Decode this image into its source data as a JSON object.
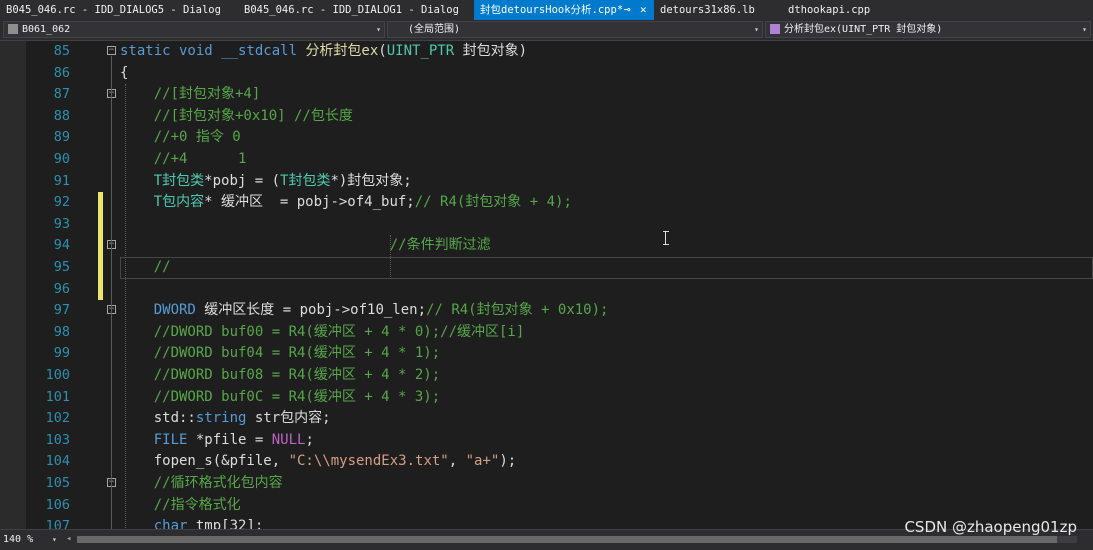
{
  "tabs": [
    {
      "label": "B045_046.rc - IDD_DIALOG5 - Dialog",
      "active": false
    },
    {
      "label": "B045_046.rc - IDD_DIALOG1 - Dialog",
      "active": false
    },
    {
      "label": "封包detoursHook分析.cpp*",
      "active": true,
      "pin": "⊸",
      "close": "✕"
    },
    {
      "label": "detours31x86.lb",
      "active": false
    },
    {
      "label": "dthookapi.cpp",
      "active": false
    }
  ],
  "nav": {
    "project": "B061_062",
    "scope": "(全局范围)",
    "member": "分析封包ex(UINT_PTR 封包对象)",
    "dropdown_glyph": "▾"
  },
  "code_lines": [
    {
      "n": "85",
      "fold": "−",
      "changed": false,
      "tokens": [
        [
          "kw",
          "static void __stdcall "
        ],
        [
          "fn",
          "分析封包ex"
        ],
        [
          "",
          "("
        ],
        [
          "ty",
          "UINT_PTR"
        ],
        [
          "",
          " 封包对象)"
        ]
      ]
    },
    {
      "n": "86",
      "fold": "",
      "changed": false,
      "tokens": [
        [
          "",
          "{"
        ]
      ]
    },
    {
      "n": "87",
      "fold": "−",
      "changed": false,
      "tokens": [
        [
          "",
          "    "
        ],
        [
          "cm",
          "//[封包对象+4]"
        ]
      ]
    },
    {
      "n": "88",
      "fold": "",
      "changed": false,
      "tokens": [
        [
          "",
          "    "
        ],
        [
          "cm",
          "//[封包对象+0x10] //包长度"
        ]
      ]
    },
    {
      "n": "89",
      "fold": "",
      "changed": false,
      "tokens": [
        [
          "",
          "    "
        ],
        [
          "cm",
          "//+0 指令 0"
        ]
      ]
    },
    {
      "n": "90",
      "fold": "",
      "changed": false,
      "tokens": [
        [
          "",
          "    "
        ],
        [
          "cm",
          "//+4      1"
        ]
      ]
    },
    {
      "n": "91",
      "fold": "",
      "changed": false,
      "tokens": [
        [
          "",
          "    "
        ],
        [
          "ty",
          "T封包类"
        ],
        [
          "",
          "*pobj = ("
        ],
        [
          "ty",
          "T封包类"
        ],
        [
          "",
          "*)封包对象;"
        ]
      ]
    },
    {
      "n": "92",
      "fold": "",
      "changed": true,
      "tokens": [
        [
          "",
          "    "
        ],
        [
          "ty",
          "T包内容"
        ],
        [
          "",
          "* 缓冲区  = pobj->of4_buf;"
        ],
        [
          "cm",
          "// R4(封包对象 + 4);"
        ]
      ]
    },
    {
      "n": "93",
      "fold": "",
      "changed": true,
      "tokens": [
        [
          "",
          ""
        ]
      ]
    },
    {
      "n": "94",
      "fold": "−",
      "changed": true,
      "tokens": [
        [
          "",
          "                                "
        ],
        [
          "cm",
          "//条件判断过滤"
        ]
      ]
    },
    {
      "n": "95",
      "fold": "",
      "changed": true,
      "tokens": [
        [
          "",
          "    "
        ],
        [
          "cm",
          "//"
        ]
      ]
    },
    {
      "n": "96",
      "fold": "",
      "changed": true,
      "tokens": [
        [
          "",
          ""
        ]
      ]
    },
    {
      "n": "97",
      "fold": "−",
      "changed": false,
      "tokens": [
        [
          "",
          "    "
        ],
        [
          "kw",
          "DWORD"
        ],
        [
          "",
          " 缓冲区长度 = pobj->of10_len;"
        ],
        [
          "cm",
          "// R4(封包对象 + 0x10);"
        ]
      ]
    },
    {
      "n": "98",
      "fold": "",
      "changed": false,
      "tokens": [
        [
          "",
          "    "
        ],
        [
          "cm",
          "//DWORD buf00 = R4(缓冲区 + 4 * 0);//缓冲区[i]"
        ]
      ]
    },
    {
      "n": "99",
      "fold": "",
      "changed": false,
      "tokens": [
        [
          "",
          "    "
        ],
        [
          "cm",
          "//DWORD buf04 = R4(缓冲区 + 4 * 1);"
        ]
      ]
    },
    {
      "n": "100",
      "fold": "",
      "changed": false,
      "tokens": [
        [
          "",
          "    "
        ],
        [
          "cm",
          "//DWORD buf08 = R4(缓冲区 + 4 * 2);"
        ]
      ]
    },
    {
      "n": "101",
      "fold": "",
      "changed": false,
      "tokens": [
        [
          "",
          "    "
        ],
        [
          "cm",
          "//DWORD buf0C = R4(缓冲区 + 4 * 3);"
        ]
      ]
    },
    {
      "n": "102",
      "fold": "",
      "changed": false,
      "tokens": [
        [
          "",
          "    std::"
        ],
        [
          "kw",
          "string"
        ],
        [
          "",
          " str包内容;"
        ]
      ]
    },
    {
      "n": "103",
      "fold": "",
      "changed": false,
      "tokens": [
        [
          "",
          "    "
        ],
        [
          "kw",
          "FILE"
        ],
        [
          "",
          " *pfile = "
        ],
        [
          "mac",
          "NULL"
        ],
        [
          "",
          ";"
        ]
      ]
    },
    {
      "n": "104",
      "fold": "",
      "changed": false,
      "tokens": [
        [
          "",
          "    fopen_s(&pfile, "
        ],
        [
          "st",
          "\"C:\\\\mysendEx3.txt\""
        ],
        [
          "",
          ", "
        ],
        [
          "st",
          "\"a+\""
        ],
        [
          "",
          ");"
        ]
      ]
    },
    {
      "n": "105",
      "fold": "−",
      "changed": false,
      "tokens": [
        [
          "",
          "    "
        ],
        [
          "cm",
          "//循环格式化包内容"
        ]
      ]
    },
    {
      "n": "106",
      "fold": "",
      "changed": false,
      "tokens": [
        [
          "",
          "    "
        ],
        [
          "cm",
          "//指令格式化"
        ]
      ]
    },
    {
      "n": "107",
      "fold": "",
      "changed": false,
      "tokens": [
        [
          "",
          "    "
        ],
        [
          "kw",
          "char"
        ],
        [
          "",
          " tmp[32];"
        ]
      ]
    }
  ],
  "current_line": "95",
  "status": {
    "zoom": "140 %",
    "zoom_dropdown": "▾",
    "scroll_left": "◂"
  },
  "watermark": "CSDN @zhaopeng01zp",
  "colors": {
    "background": "#1e1e1e",
    "line_number": "#2b91af",
    "keyword": "#569cd6",
    "comment": "#57a64a",
    "string": "#d69d85",
    "type": "#4ec9b0",
    "macro": "#bd63c5",
    "change_marker": "#efe36f",
    "active_tab": "#007acc"
  },
  "scroll": {
    "horizontal_visible_fraction": 0.98
  }
}
